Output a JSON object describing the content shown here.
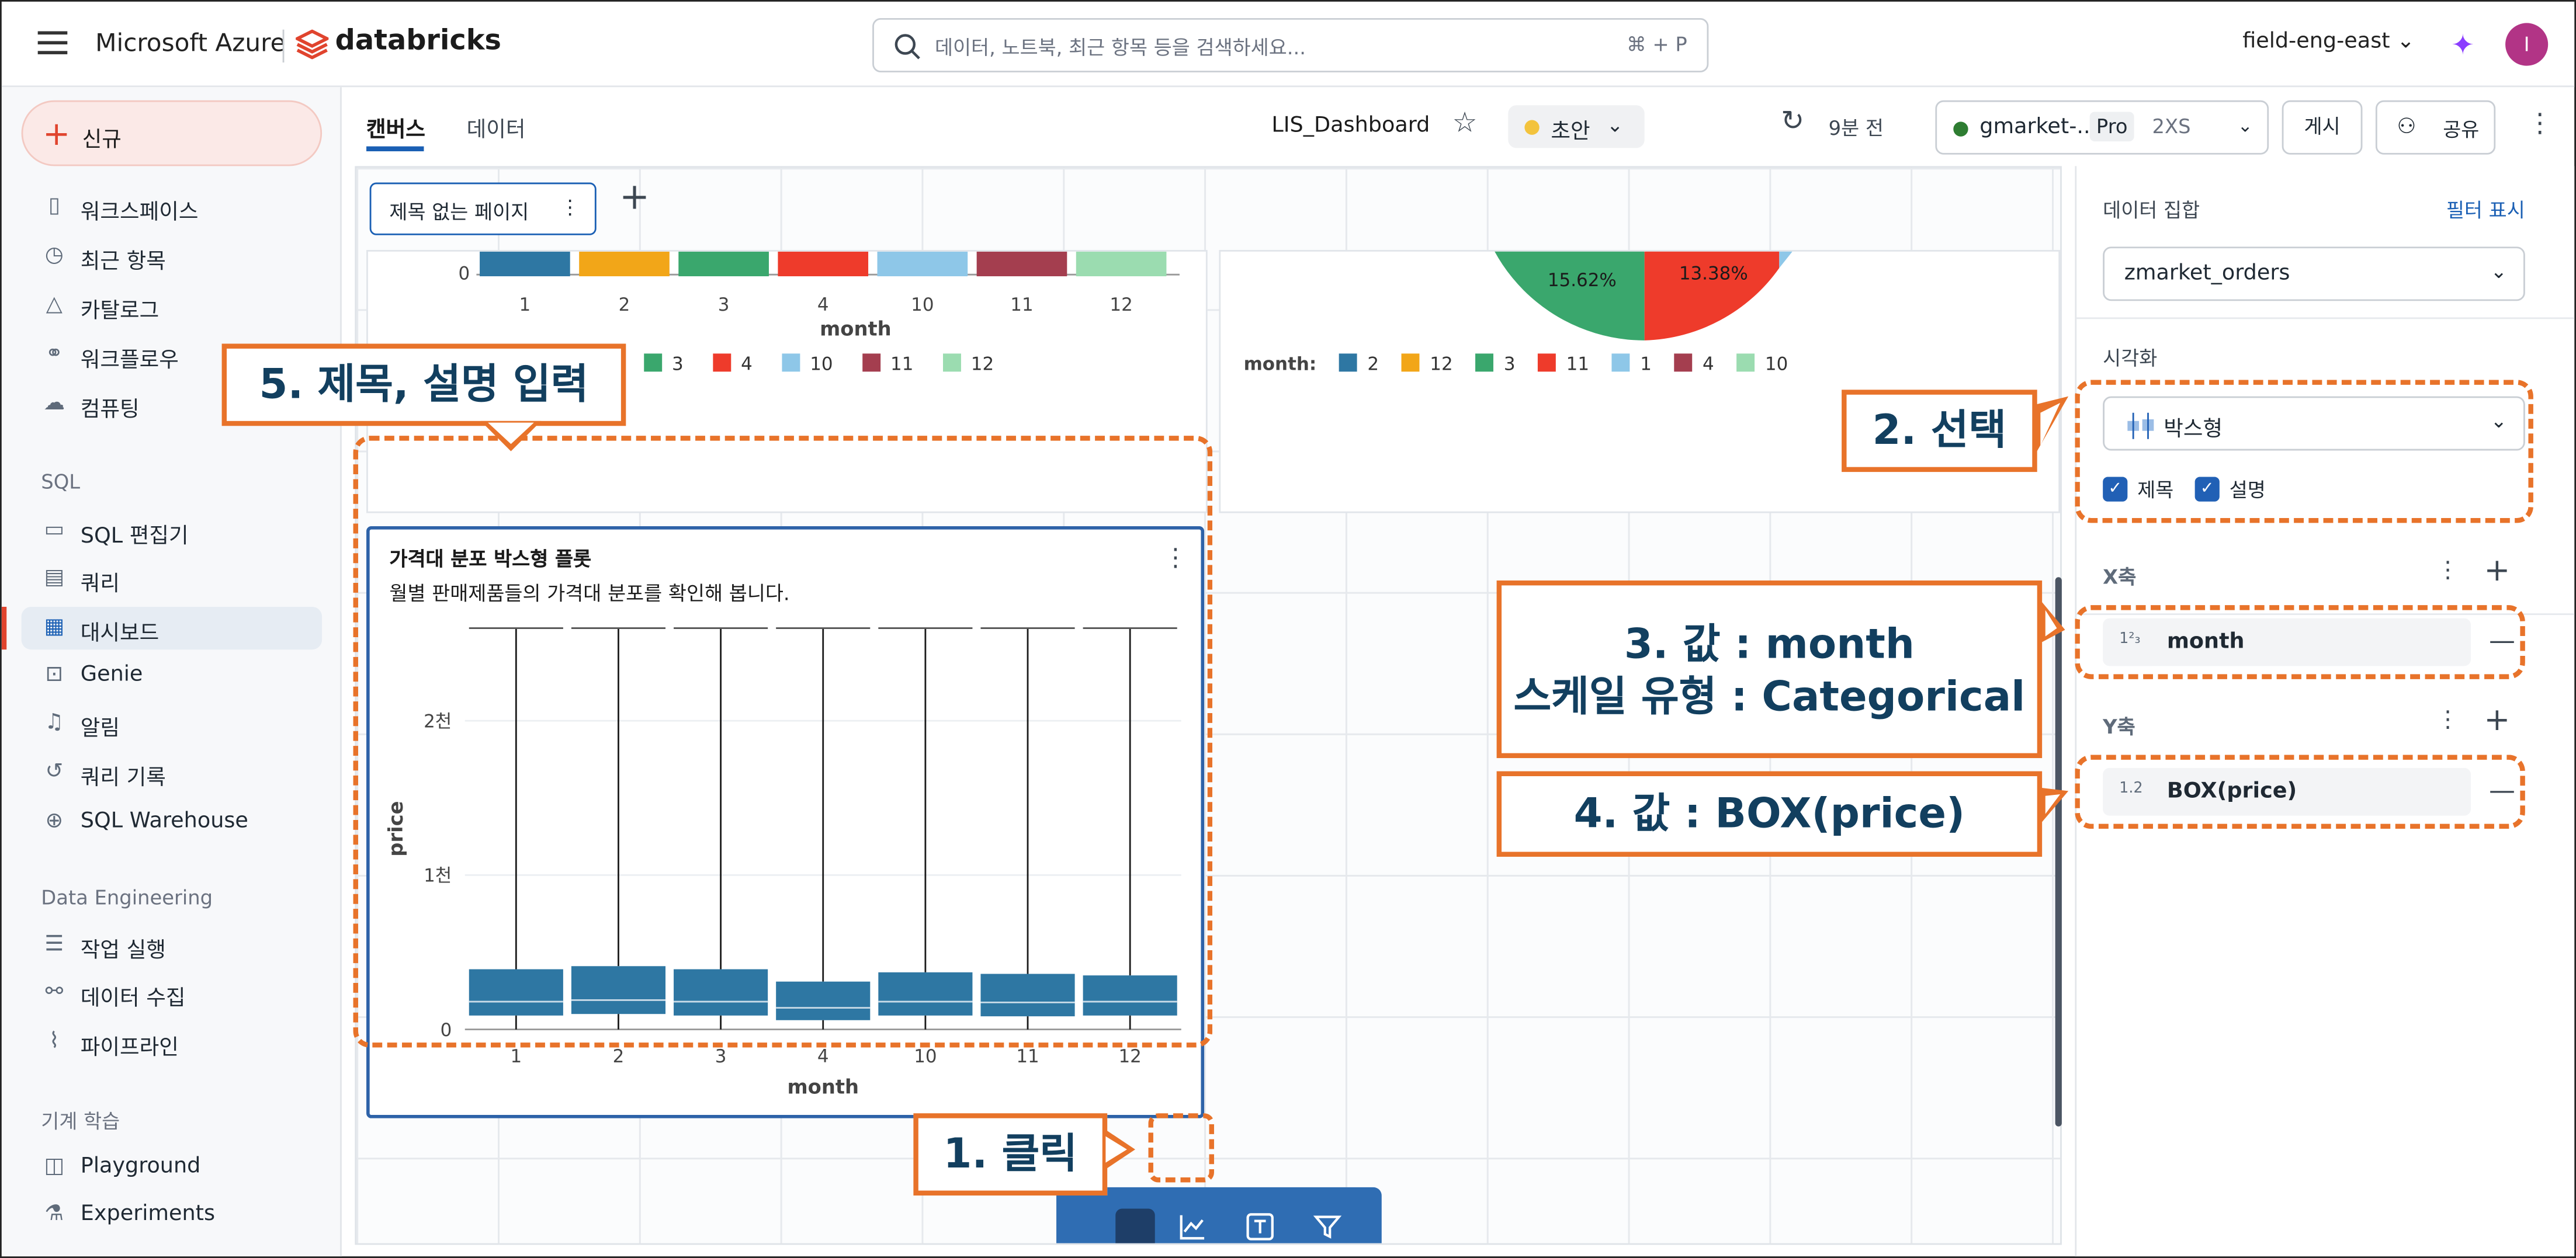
{
  "header": {
    "brand": "Microsoft Azure",
    "product": "databricks",
    "search_placeholder": "데이터, 노트북, 최근 항목 등을 검색하세요...",
    "search_shortcut": "⌘ + P",
    "workspace": "field-eng-east",
    "avatar_initial": "I"
  },
  "sidebar": {
    "new_label": "신규",
    "items": [
      {
        "label": "워크스페이스",
        "icon": "folder-icon"
      },
      {
        "label": "최근 항목",
        "icon": "clock-icon"
      },
      {
        "label": "카탈로그",
        "icon": "catalog-icon"
      },
      {
        "label": "워크플로우",
        "icon": "workflow-icon"
      },
      {
        "label": "컴퓨팅",
        "icon": "cloud-icon"
      }
    ],
    "sql_section": "SQL",
    "sql_items": [
      {
        "label": "SQL 편집기",
        "icon": "editor-icon"
      },
      {
        "label": "쿼리",
        "icon": "query-icon"
      },
      {
        "label": "대시보드",
        "icon": "dashboard-icon"
      },
      {
        "label": "Genie",
        "icon": "genie-icon"
      },
      {
        "label": "알림",
        "icon": "bell-icon"
      },
      {
        "label": "쿼리 기록",
        "icon": "history-icon"
      },
      {
        "label": "SQL Warehouse",
        "icon": "warehouse-icon"
      }
    ],
    "de_section": "Data Engineering",
    "de_items": [
      {
        "label": "작업 실행",
        "icon": "runs-icon"
      },
      {
        "label": "데이터 수집",
        "icon": "ingest-icon"
      },
      {
        "label": "파이프라인",
        "icon": "pipeline-icon"
      }
    ],
    "ml_section": "기계 학습",
    "ml_items": [
      {
        "label": "Playground",
        "icon": "robot-icon"
      },
      {
        "label": "Experiments",
        "icon": "flask-icon"
      }
    ]
  },
  "main": {
    "tabs": [
      "캔버스",
      "데이터"
    ],
    "dashboard_title": "LIS_Dashboard",
    "status": "초안",
    "refreshed": "9분 전",
    "cluster_name": "gmarket-...",
    "cluster_tier": "Pro",
    "cluster_size": "2XS",
    "publish": "게시",
    "share": "공유",
    "page_tab": "제목 없는 페이지"
  },
  "top_bar_widget": {
    "y_tick": "0",
    "categories": [
      "1",
      "2",
      "3",
      "4",
      "10",
      "11",
      "12"
    ],
    "xlabel": "month",
    "legend": [
      {
        "label": "3",
        "color": "#3aa76d"
      },
      {
        "label": "4",
        "color": "#ee3b2b"
      },
      {
        "label": "10",
        "color": "#8ec7e8"
      },
      {
        "label": "11",
        "color": "#a43e4f"
      },
      {
        "label": "12",
        "color": "#9bdcb0"
      }
    ],
    "colors": [
      "#2e77a3",
      "#f2a618",
      "#3aa76d",
      "#ee3b2b",
      "#8ec7e8",
      "#a43e4f",
      "#9bdcb0"
    ]
  },
  "pie_widget": {
    "labels": [
      "15.62%",
      "13.38%"
    ],
    "legend_title": "month:",
    "legend": [
      {
        "label": "2",
        "color": "#2e77a3"
      },
      {
        "label": "12",
        "color": "#f2a618"
      },
      {
        "label": "3",
        "color": "#3aa76d"
      },
      {
        "label": "11",
        "color": "#ee3b2b"
      },
      {
        "label": "1",
        "color": "#8ec7e8"
      },
      {
        "label": "4",
        "color": "#a43e4f"
      },
      {
        "label": "10",
        "color": "#9bdcb0"
      }
    ]
  },
  "box_widget": {
    "title": "가격대 분포 박스형 플롯",
    "description": "월별 판매제품들의 가격대 분포를 확인해 봅니다."
  },
  "chart_data": {
    "type": "box",
    "title": "가격대 분포 박스형 플롯",
    "subtitle": "월별 판매제품들의 가격대 분포를 확인해 봅니다.",
    "xlabel": "month",
    "ylabel": "price",
    "categories": [
      "1",
      "2",
      "3",
      "4",
      "10",
      "11",
      "12"
    ],
    "y_ticks": [
      "0",
      "1천",
      "2천"
    ],
    "ylim": [
      0,
      2600
    ],
    "series": [
      {
        "values": [
          {
            "min": 0,
            "q1": 90,
            "median": 180,
            "q3": 390,
            "max": 2600
          },
          {
            "min": 0,
            "q1": 100,
            "median": 190,
            "q3": 410,
            "max": 2600
          },
          {
            "min": 0,
            "q1": 90,
            "median": 180,
            "q3": 390,
            "max": 2600
          },
          {
            "min": 0,
            "q1": 60,
            "median": 140,
            "q3": 310,
            "max": 2600
          },
          {
            "min": 0,
            "q1": 90,
            "median": 180,
            "q3": 370,
            "max": 2600
          },
          {
            "min": 0,
            "q1": 85,
            "median": 175,
            "q3": 360,
            "max": 2600
          },
          {
            "min": 0,
            "q1": 90,
            "median": 180,
            "q3": 350,
            "max": 2600
          }
        ]
      }
    ],
    "color": "#2e77a3"
  },
  "right_panel": {
    "dataset_label": "데이터 집합",
    "filter_link": "필터 표시",
    "dataset": "zmarket_orders",
    "viz_label": "시각화",
    "viz_value": "박스형",
    "check_title": "제목",
    "check_desc": "설명",
    "x_label": "X축",
    "x_type": "1²₃",
    "x_field": "month",
    "y_label": "Y축",
    "y_type": "1.2",
    "y_field": "BOX(price)"
  },
  "annotations": {
    "click": "1. 클릭",
    "select": "2. 선택",
    "x_line1": "3. 값 : month",
    "x_line2": "스케일 유형 : Categorical",
    "y_value": "4. 값 : BOX(price)",
    "title_desc": "5. 제목, 설명 입력"
  }
}
